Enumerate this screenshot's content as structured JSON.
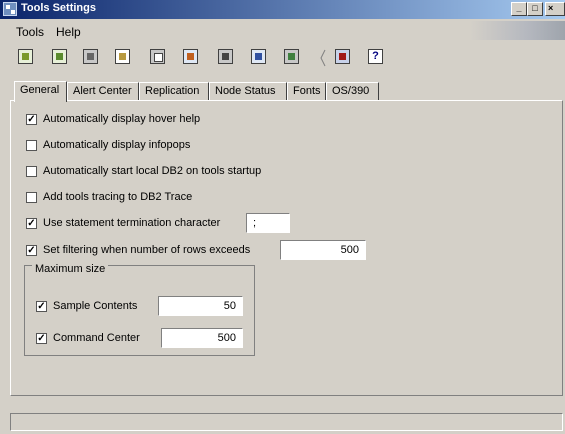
{
  "window": {
    "title": "Tools Settings"
  },
  "menu": {
    "items": [
      "Tools",
      "Help"
    ]
  },
  "toolbar": {
    "buttons": [
      "open-icon",
      "refresh-icon",
      "copy-icon",
      "settings-icon",
      "document-icon",
      "image-icon",
      "list-icon",
      "window-icon",
      "gear-icon",
      "book-icon",
      "help-icon"
    ],
    "help_label": "?"
  },
  "tabs": [
    "General",
    "Alert Center",
    "Replication",
    "Node Status",
    "Fonts",
    "OS/390"
  ],
  "general": {
    "options": [
      {
        "label": "Automatically display hover help",
        "checked": true
      },
      {
        "label": "Automatically display infopops",
        "checked": false
      },
      {
        "label": "Automatically start local DB2 on tools startup",
        "checked": false
      },
      {
        "label": "Add tools tracing to DB2 Trace",
        "checked": false
      },
      {
        "label": "Use statement termination character",
        "checked": true,
        "value": ";"
      },
      {
        "label": "Set filtering when number of rows exceeds",
        "checked": true,
        "value": "500"
      }
    ],
    "max_size": {
      "title": "Maximum size",
      "items": [
        {
          "label": "Sample Contents",
          "checked": true,
          "value": "50"
        },
        {
          "label": "Command Center",
          "checked": true,
          "value": "500"
        }
      ]
    }
  }
}
